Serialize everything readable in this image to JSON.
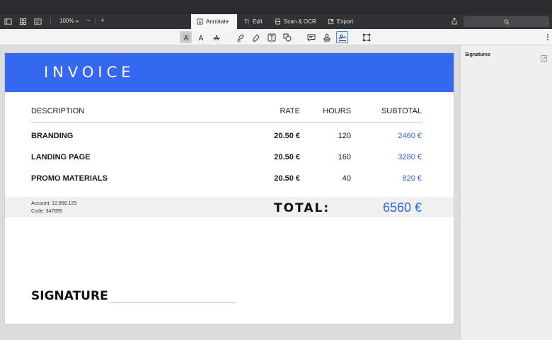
{
  "toolbar": {
    "zoom_label": "100%",
    "zoom_out_label": "−",
    "zoom_in_label": "+",
    "tabs": [
      {
        "label": "Annotate",
        "icon": "annotate-icon",
        "active": true
      },
      {
        "label": "Edit",
        "icon": "edit-text-icon",
        "active": false
      },
      {
        "label": "Scan & OCR",
        "icon": "scan-icon",
        "active": false
      },
      {
        "label": "Export",
        "icon": "export-icon",
        "active": false
      }
    ]
  },
  "annotation_tools": [
    "text-highlight-icon",
    "text-style-icon",
    "strikethrough-icon",
    "highlighter-icon",
    "eraser-icon",
    "text-box-icon",
    "shapes-icon",
    "note-icon",
    "stamp-icon",
    "signature-icon",
    "crop-icon"
  ],
  "invoice": {
    "title": "INVOICE",
    "headers": {
      "description": "DESCRIPTION",
      "rate": "RATE",
      "hours": "HOURS",
      "subtotal": "SUBTOTAL"
    },
    "rows": [
      {
        "description": "BRANDING",
        "rate": "20.50 €",
        "hours": "120",
        "subtotal": "2460 €"
      },
      {
        "description": "LANDING PAGE",
        "rate": "20.50 €",
        "hours": "160",
        "subtotal": "3280 €"
      },
      {
        "description": "PROMO MATERIALS",
        "rate": "20.50 €",
        "hours": "40",
        "subtotal": "820 €"
      }
    ],
    "account": "Account:  12.856.129",
    "code": "Code:  347895",
    "total_label": "TOTAL:",
    "total_value": "6560 €",
    "signature_label": "SIGNATURE"
  },
  "sidebar": {
    "title": "Signatures"
  },
  "colors": {
    "banner": "#3567f0",
    "accent": "#2f66d4",
    "titlebar": "#2b2b2d",
    "toolbar": "#323234"
  }
}
